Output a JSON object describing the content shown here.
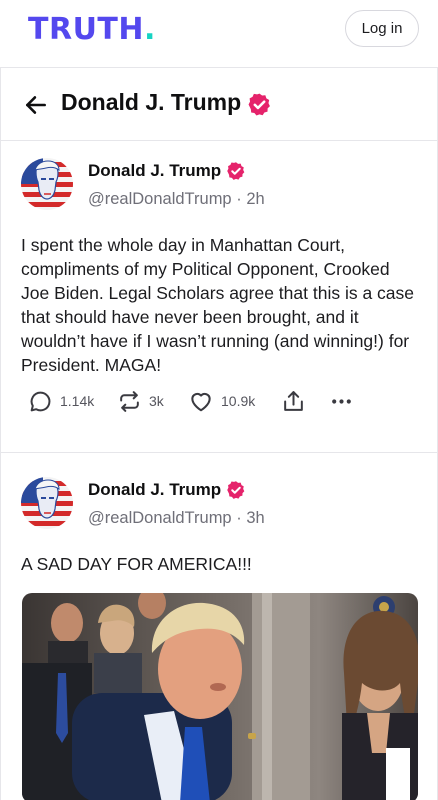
{
  "header": {
    "logo_text": "TRUTH",
    "logo_dot": ".",
    "login_label": "Log in",
    "brand_color": "#5448EE",
    "accent_color": "#17D3C3"
  },
  "profile": {
    "back_icon": "arrow-left-icon",
    "title": "Donald J. Trump",
    "verified_icon": "verified-badge-icon",
    "verified_color": "#E5236B"
  },
  "posts": [
    {
      "author": "Donald J. Trump",
      "handle": "@realDonaldTrump",
      "separator": "·",
      "time": "2h",
      "text": "I spent the whole day in Manhattan Court, compliments of my Political Opponent, Crooked Joe Biden. Legal Scholars agree that this is a case that should have never been brought, and it wouldn’t have if I wasn’t running (and winning!) for President. MAGA!",
      "replies": "1.14k",
      "retruths": "3k",
      "likes": "10.9k"
    },
    {
      "author": "Donald J. Trump",
      "handle": "@realDonaldTrump",
      "separator": "·",
      "time": "3h",
      "text": "A SAD DAY FOR AMERICA!!!"
    }
  ]
}
